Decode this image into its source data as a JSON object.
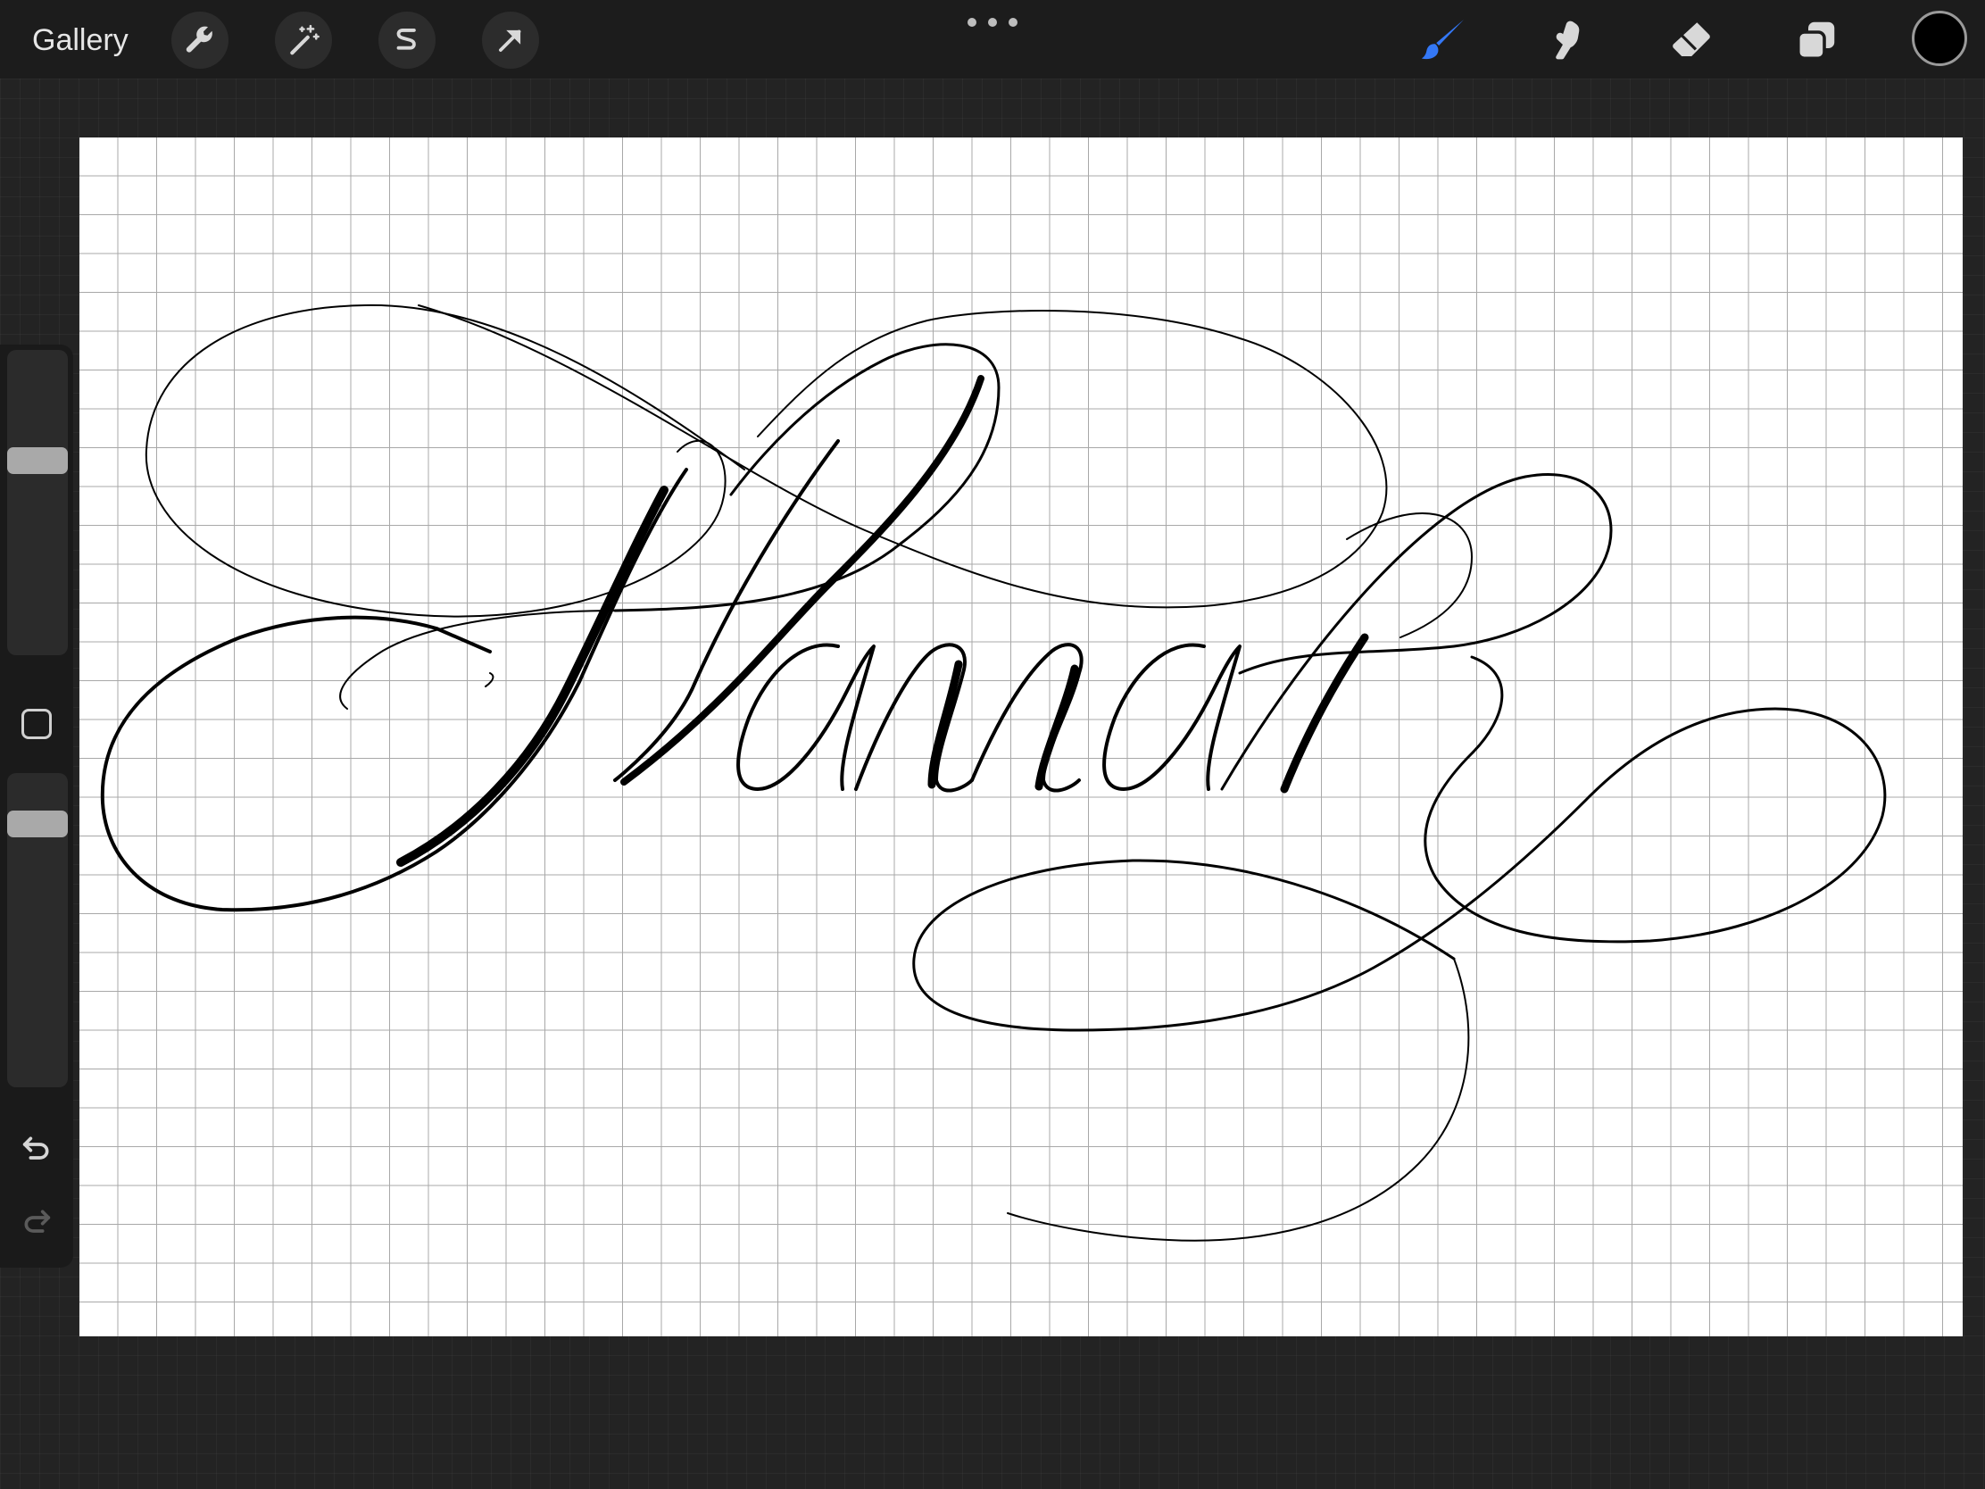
{
  "topbar": {
    "gallery_label": "Gallery",
    "left_tools": [
      {
        "name": "actions",
        "icon": "wrench-icon"
      },
      {
        "name": "adjustments",
        "icon": "magic-wand-icon"
      },
      {
        "name": "selection",
        "icon": "selection-s-icon"
      },
      {
        "name": "transform",
        "icon": "arrow-cursor-icon"
      }
    ],
    "more_icon": "more-dots-icon",
    "right_tools": [
      {
        "name": "brush",
        "icon": "brush-icon",
        "active": true
      },
      {
        "name": "smudge",
        "icon": "smudge-finger-icon",
        "active": false
      },
      {
        "name": "eraser",
        "icon": "eraser-icon",
        "active": false
      },
      {
        "name": "layers",
        "icon": "layers-icon",
        "active": false
      }
    ],
    "current_color": "#000000",
    "active_accent": "#3478f6"
  },
  "sidebar": {
    "brush_size_level": 0.65,
    "opacity_level": 0.87,
    "modify_icon": "square-modify-icon",
    "undo_icon": "undo-icon",
    "redo_icon": "redo-icon"
  },
  "canvas": {
    "background": "#ffffff",
    "grid_color": "#a8a8a8",
    "lettering": "Hannah"
  }
}
